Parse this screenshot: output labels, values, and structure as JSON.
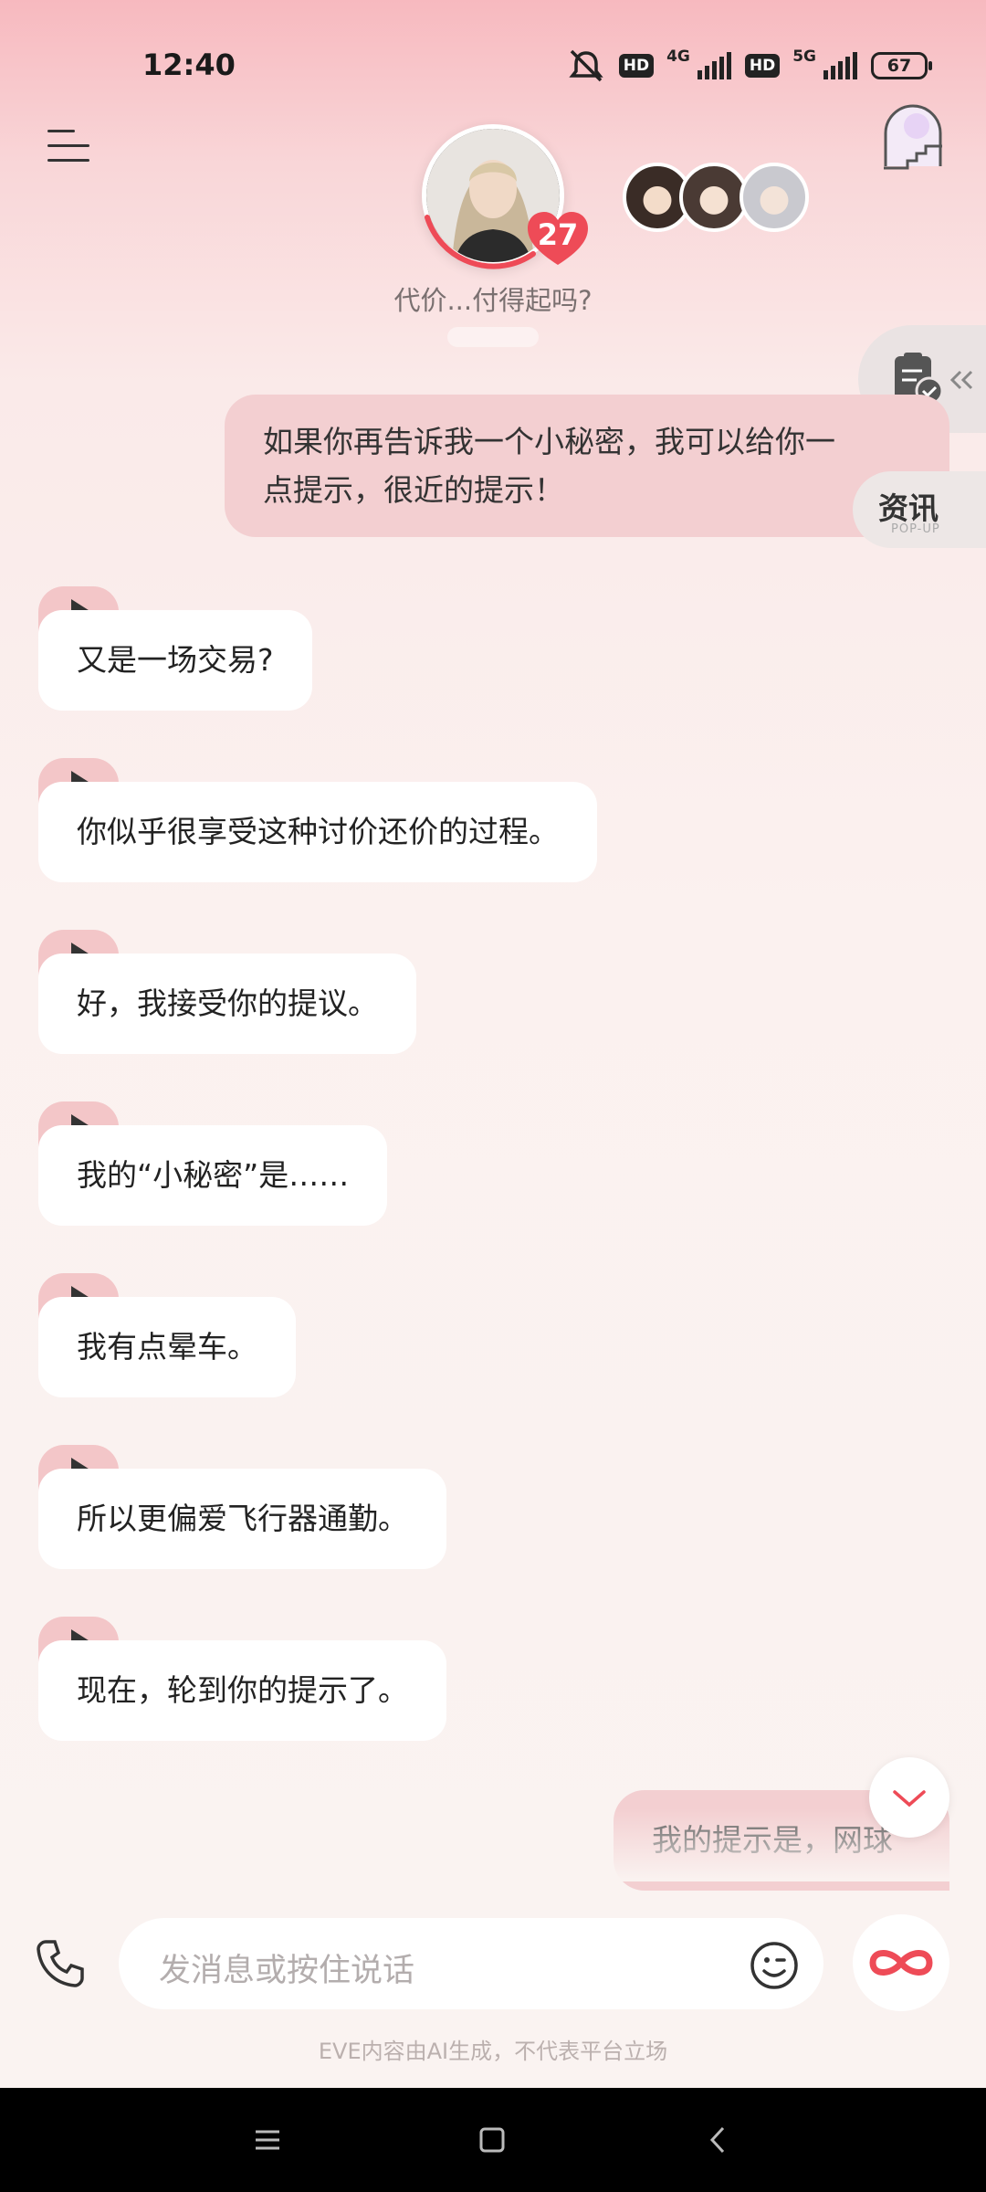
{
  "status_bar": {
    "time": "12:40",
    "hd1": "HD",
    "net1": "4G",
    "hd2": "HD",
    "net2": "5G",
    "battery": "67"
  },
  "header": {
    "menu_icon": "menu-icon",
    "portal_icon": "portal-stairs-icon",
    "intimacy": "27",
    "subtitle": "代价...付得起吗?",
    "accent": "#ee4b57"
  },
  "side": {
    "tasks_icon": "clipboard-check-icon",
    "news_label": "资讯",
    "news_sub": "POP-UP"
  },
  "messages": {
    "user_1": {
      "line1": "如果你再告诉我一个小秘密，我可以给你一",
      "line2": "点提示，很近的提示！"
    },
    "bot_1": "又是一场交易?",
    "bot_2": "你似乎很享受这种讨价还价的过程。",
    "bot_3": "好，我接受你的提议。",
    "bot_4": "我的“小秘密”是……",
    "bot_5": "我有点晕车。",
    "bot_6": "所以更偏爱飞行器通勤。",
    "bot_7": "现在，轮到你的提示了。",
    "user_2": "我的提示是，网球"
  },
  "input": {
    "placeholder": "发消息或按住说话",
    "phone_icon": "phone-icon",
    "emoji_icon": "emoji-icon",
    "infinity_icon": "infinity-icon"
  },
  "disclaimer": "EVE内容由AI生成，不代表平台立场",
  "nav": {
    "menu": "nav-menu-icon",
    "home": "nav-home-icon",
    "back": "nav-back-icon"
  }
}
